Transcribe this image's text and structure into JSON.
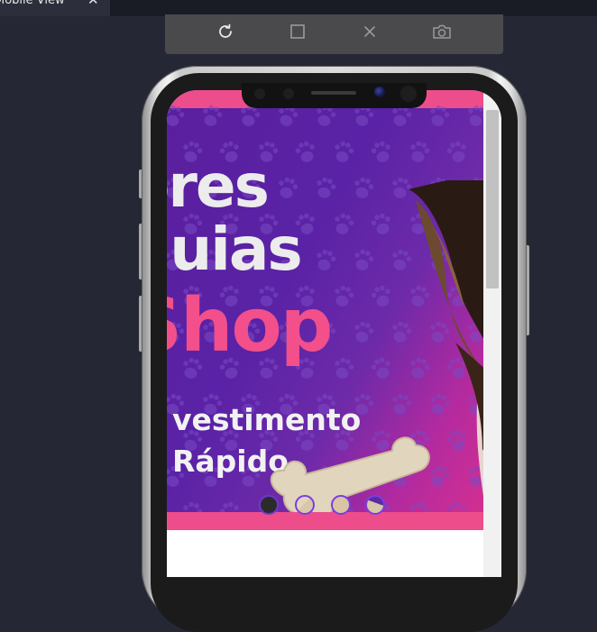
{
  "tab": {
    "label": "Mobile View",
    "close_glyph": "✕"
  },
  "toolbar": {
    "tools": [
      {
        "name": "reload-icon"
      },
      {
        "name": "square-icon"
      },
      {
        "name": "close-icon"
      },
      {
        "name": "camera-icon"
      }
    ]
  },
  "banner": {
    "line1": "ores",
    "line2": "quias",
    "line3": "Shop",
    "sub1": "vestimento",
    "sub2": "Rápido",
    "carousel_dots": 4
  },
  "colors": {
    "background": "#252834",
    "accent_pink": "#ee4d8c",
    "banner_purple": "#5a1f9e",
    "dot_border": "#7a3fe0"
  }
}
